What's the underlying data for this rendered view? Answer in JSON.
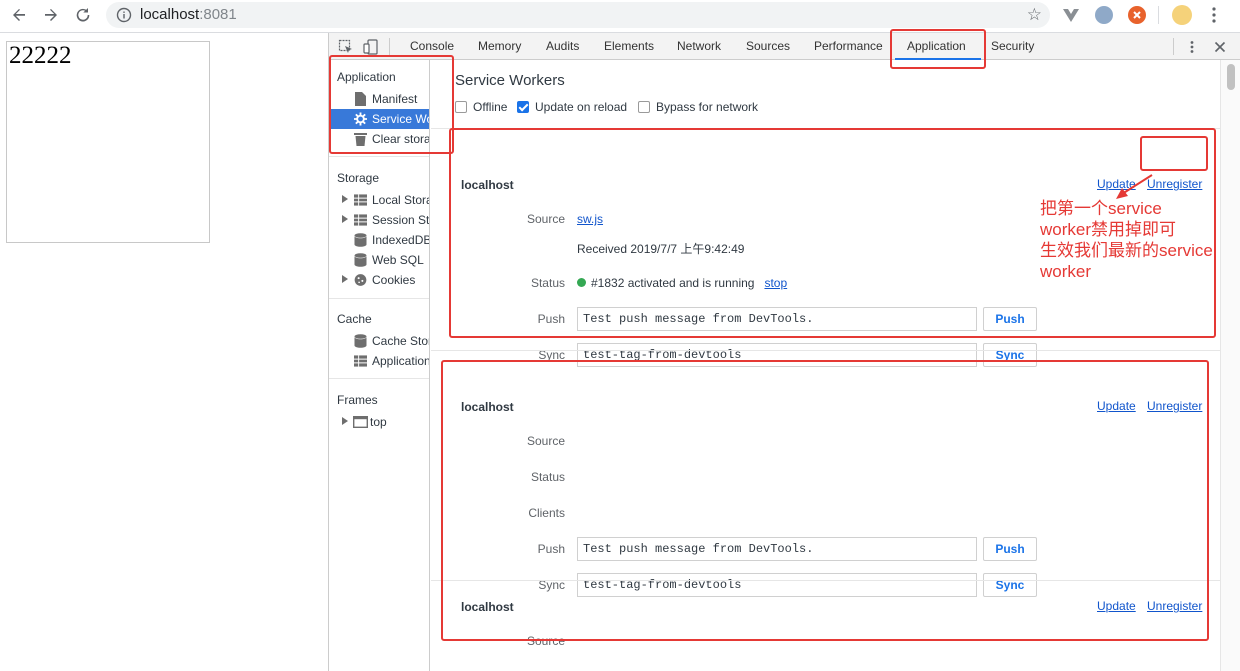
{
  "browser": {
    "url_host": "localhost",
    "url_port": ":8081"
  },
  "page": {
    "content_text": "22222"
  },
  "devtools": {
    "tabs": [
      "Console",
      "Memory",
      "Audits",
      "Elements",
      "Network",
      "Sources",
      "Performance",
      "Application",
      "Security"
    ],
    "active_tab": "Application",
    "sidebar": {
      "application_header": "Application",
      "application_items": [
        "Manifest",
        "Service Workers",
        "Clear storage"
      ],
      "selected_item": "Service Workers",
      "storage_header": "Storage",
      "storage_items": [
        "Local Storage",
        "Session Storage",
        "IndexedDB",
        "Web SQL",
        "Cookies"
      ],
      "cache_header": "Cache",
      "cache_items": [
        "Cache Storage",
        "Application Cache"
      ],
      "frames_header": "Frames",
      "frames_items": [
        "top"
      ]
    },
    "main": {
      "title": "Service Workers",
      "options": [
        {
          "label": "Offline",
          "checked": false
        },
        {
          "label": "Update on reload",
          "checked": true
        },
        {
          "label": "Bypass for network",
          "checked": false
        }
      ],
      "workers": [
        {
          "origin": "localhost",
          "update_label": "Update",
          "unregister_label": "Unregister",
          "source_label": "Source",
          "source_value": "sw.js",
          "received_value": "Received 2019/7/7 上午9:42:49",
          "status_label": "Status",
          "status_value": "#1832 activated and is running",
          "stop_label": "stop",
          "push_label": "Push",
          "push_value": "Test push message from DevTools.",
          "push_button": "Push",
          "sync_label": "Sync",
          "sync_value": "test-tag-from-devtools",
          "sync_button": "Sync"
        },
        {
          "origin": "localhost",
          "update_label": "Update",
          "unregister_label": "Unregister",
          "source_label": "Source",
          "status_label": "Status",
          "clients_label": "Clients",
          "push_label": "Push",
          "push_value": "Test push message from DevTools.",
          "push_button": "Push",
          "sync_label": "Sync",
          "sync_value": "test-tag-from-devtools",
          "sync_button": "Sync"
        },
        {
          "origin": "localhost",
          "update_label": "Update",
          "unregister_label": "Unregister",
          "source_label": "Source"
        }
      ]
    }
  },
  "annotation": {
    "text_lines": [
      "把第一个service",
      "worker禁用掉即可",
      "生效我们最新的service",
      "worker"
    ],
    "color": "#e53935"
  }
}
